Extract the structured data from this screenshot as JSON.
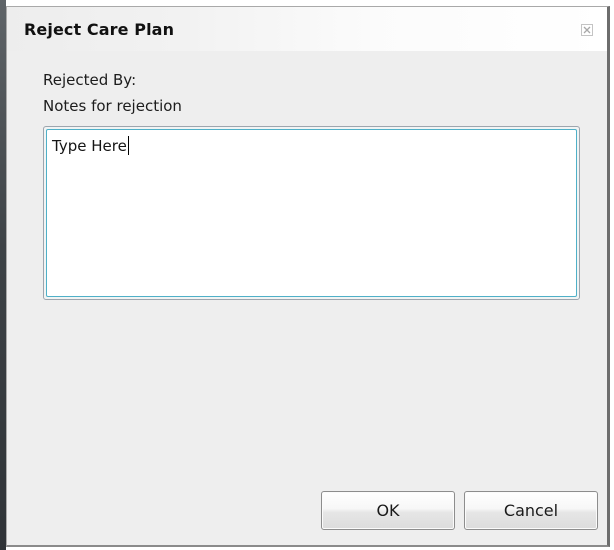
{
  "dialog": {
    "title": "Reject Care Plan",
    "close_icon": "close-icon",
    "rejected_by_label": "Rejected By:",
    "notes_label": "Notes for rejection",
    "notes_value": "Type Here",
    "ok_label": "OK",
    "cancel_label": "Cancel"
  },
  "colors": {
    "dialog_background": "#eeeeee",
    "textbox_focus_border": "#4fb0c8",
    "backdrop": "#3d4246"
  }
}
